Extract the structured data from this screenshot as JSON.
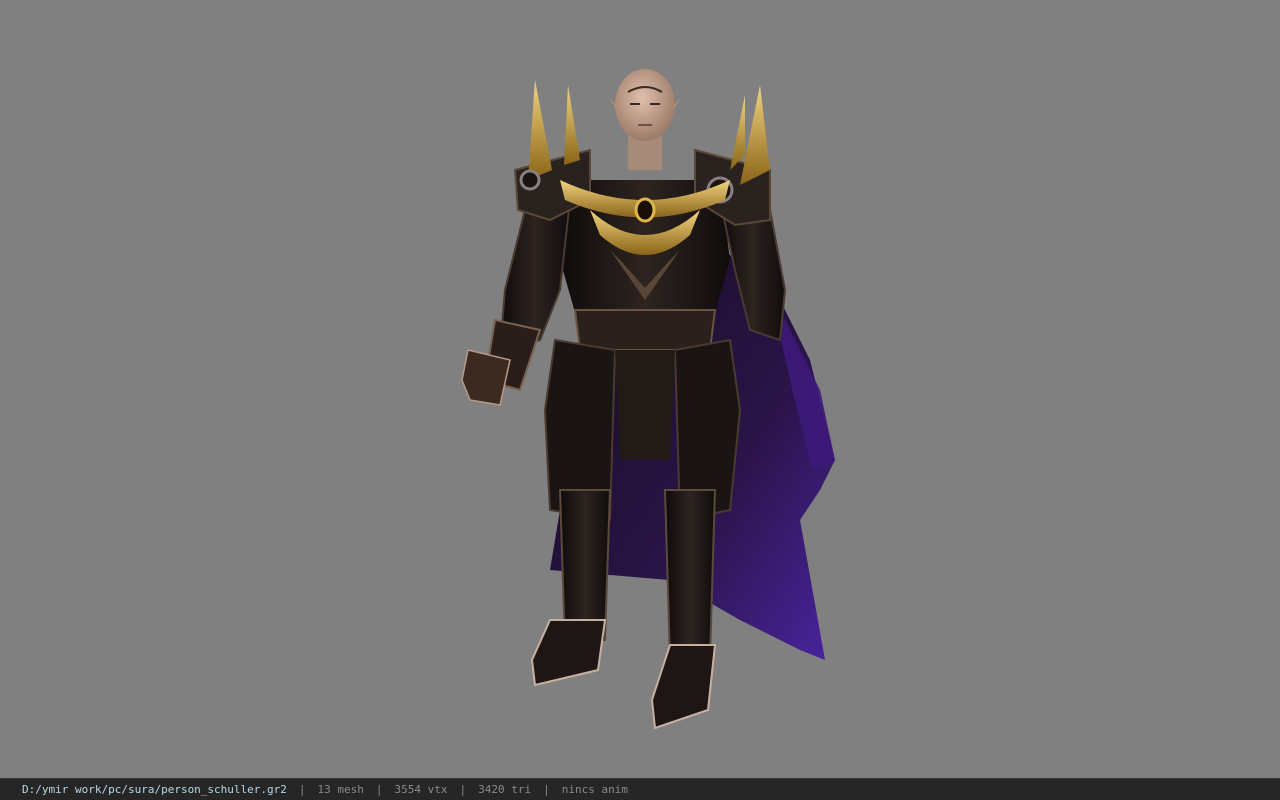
{
  "status_bar": {
    "file_path": "D:/ymir work/pc/sura/person_schuller.gr2",
    "separator": "|",
    "mesh": "13 mesh",
    "vertices": "3554 vtx",
    "triangles": "3420 tri",
    "animation": "nincs anim"
  },
  "viewport": {
    "background_color": "#808080",
    "subject": "armored-character-model"
  },
  "colors": {
    "status_bar_bg": "#262626",
    "path_text": "#b6d6e8",
    "stat_text": "#8a8a8a",
    "armor_dark": "#1c1614",
    "armor_gold": "#c9a34a",
    "cape_purple": "#3b1a66",
    "skin": "#c9a590"
  }
}
